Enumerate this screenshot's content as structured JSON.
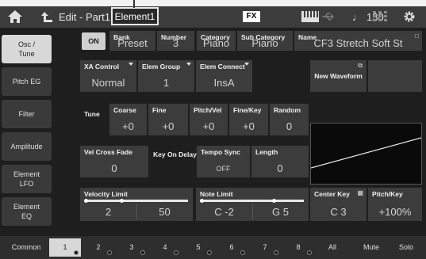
{
  "header": {
    "breadcrumb": "Edit - Part1",
    "active_tab": "Element1",
    "fx_label": "FX",
    "tempo": "130"
  },
  "sidebar": {
    "items": [
      {
        "label": "Osc / Tune",
        "line1": "Osc /",
        "line2": "Tune",
        "active": true
      },
      {
        "label": "Pitch EG",
        "line1": "Pitch EG",
        "line2": ""
      },
      {
        "label": "Filter",
        "line1": "Filter",
        "line2": ""
      },
      {
        "label": "Amplitude",
        "line1": "Amplitude",
        "line2": ""
      },
      {
        "label": "Element LFO",
        "line1": "Element",
        "line2": "LFO"
      },
      {
        "label": "Element EQ",
        "line1": "Element",
        "line2": "EQ"
      }
    ]
  },
  "osc": {
    "on_label": "ON",
    "bank_label": "Bank",
    "bank_value": "Preset",
    "number_label": "Number",
    "number_value": "3",
    "category_label": "Category",
    "category_value": "Piano",
    "subcategory_label": "Sub Category",
    "subcategory_value": "Piano",
    "name_label": "Name",
    "name_value": "CF3 Stretch Soft St"
  },
  "element": {
    "xa_label": "XA Control",
    "xa_value": "Normal",
    "group_label": "Elem Group",
    "group_value": "1",
    "connect_label": "Elem Connect",
    "connect_value": "InsA",
    "new_waveform_label": "New Waveform"
  },
  "tune": {
    "section_label": "Tune",
    "coarse_label": "Coarse",
    "coarse_value": "+0",
    "fine_label": "Fine",
    "fine_value": "+0",
    "pitchvel_label": "Pitch/Vel",
    "pitchvel_value": "+0",
    "finekey_label": "Fine/Key",
    "finekey_value": "+0",
    "random_label": "Random",
    "random_value": "0"
  },
  "misc": {
    "velxfade_label": "Vel Cross Fade",
    "velxfade_value": "0",
    "keyondelay_label": "Key On Delay",
    "temposync_label": "Tempo Sync",
    "temposync_value": "OFF",
    "length_label": "Length",
    "length_value": "0"
  },
  "limits": {
    "velocity_label": "Velocity Limit",
    "velocity_low": "2",
    "velocity_high": "50",
    "note_label": "Note Limit",
    "note_low": "C -2",
    "note_high": "G 5",
    "centerkey_label": "Center Key",
    "centerkey_value": "C 3",
    "pitchkey_label": "Pitch/Key",
    "pitchkey_value": "+100%"
  },
  "footer": {
    "common_label": "Common",
    "parts": [
      "1",
      "2",
      "3",
      "4",
      "5",
      "6",
      "7",
      "8"
    ],
    "all_label": "All",
    "mute_label": "Mute",
    "solo_label": "Solo"
  }
}
